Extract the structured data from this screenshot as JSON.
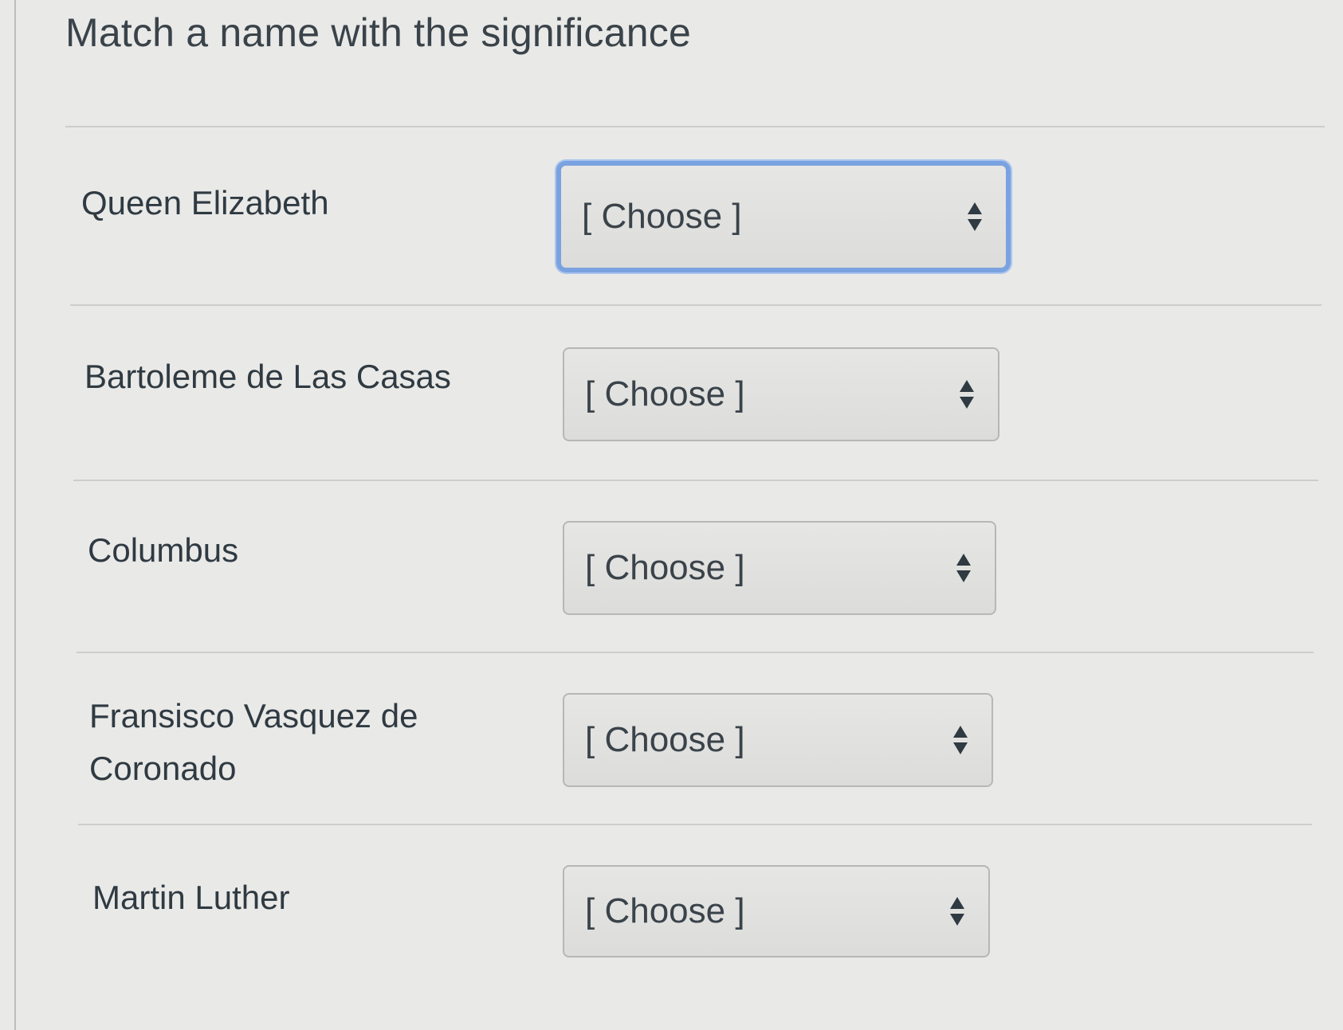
{
  "question": {
    "title": "Match a name with the significance"
  },
  "rows": [
    {
      "name": "Queen Elizabeth",
      "selected": "[ Choose ]",
      "focused": true
    },
    {
      "name": "Bartoleme de Las Casas",
      "selected": "[ Choose ]",
      "focused": false
    },
    {
      "name": "Columbus",
      "selected": "[ Choose ]",
      "focused": false
    },
    {
      "name": "Fransisco Vasquez de Coronado",
      "selected": "[ Choose ]",
      "focused": false
    },
    {
      "name": "Martin Luther",
      "selected": "[ Choose ]",
      "focused": false
    }
  ],
  "icons": {
    "select_arrows": "up-down-arrows-icon"
  },
  "colors": {
    "focus_ring": "#7aa2e0",
    "background": "#e9e9e7",
    "text": "#2f3a42"
  }
}
